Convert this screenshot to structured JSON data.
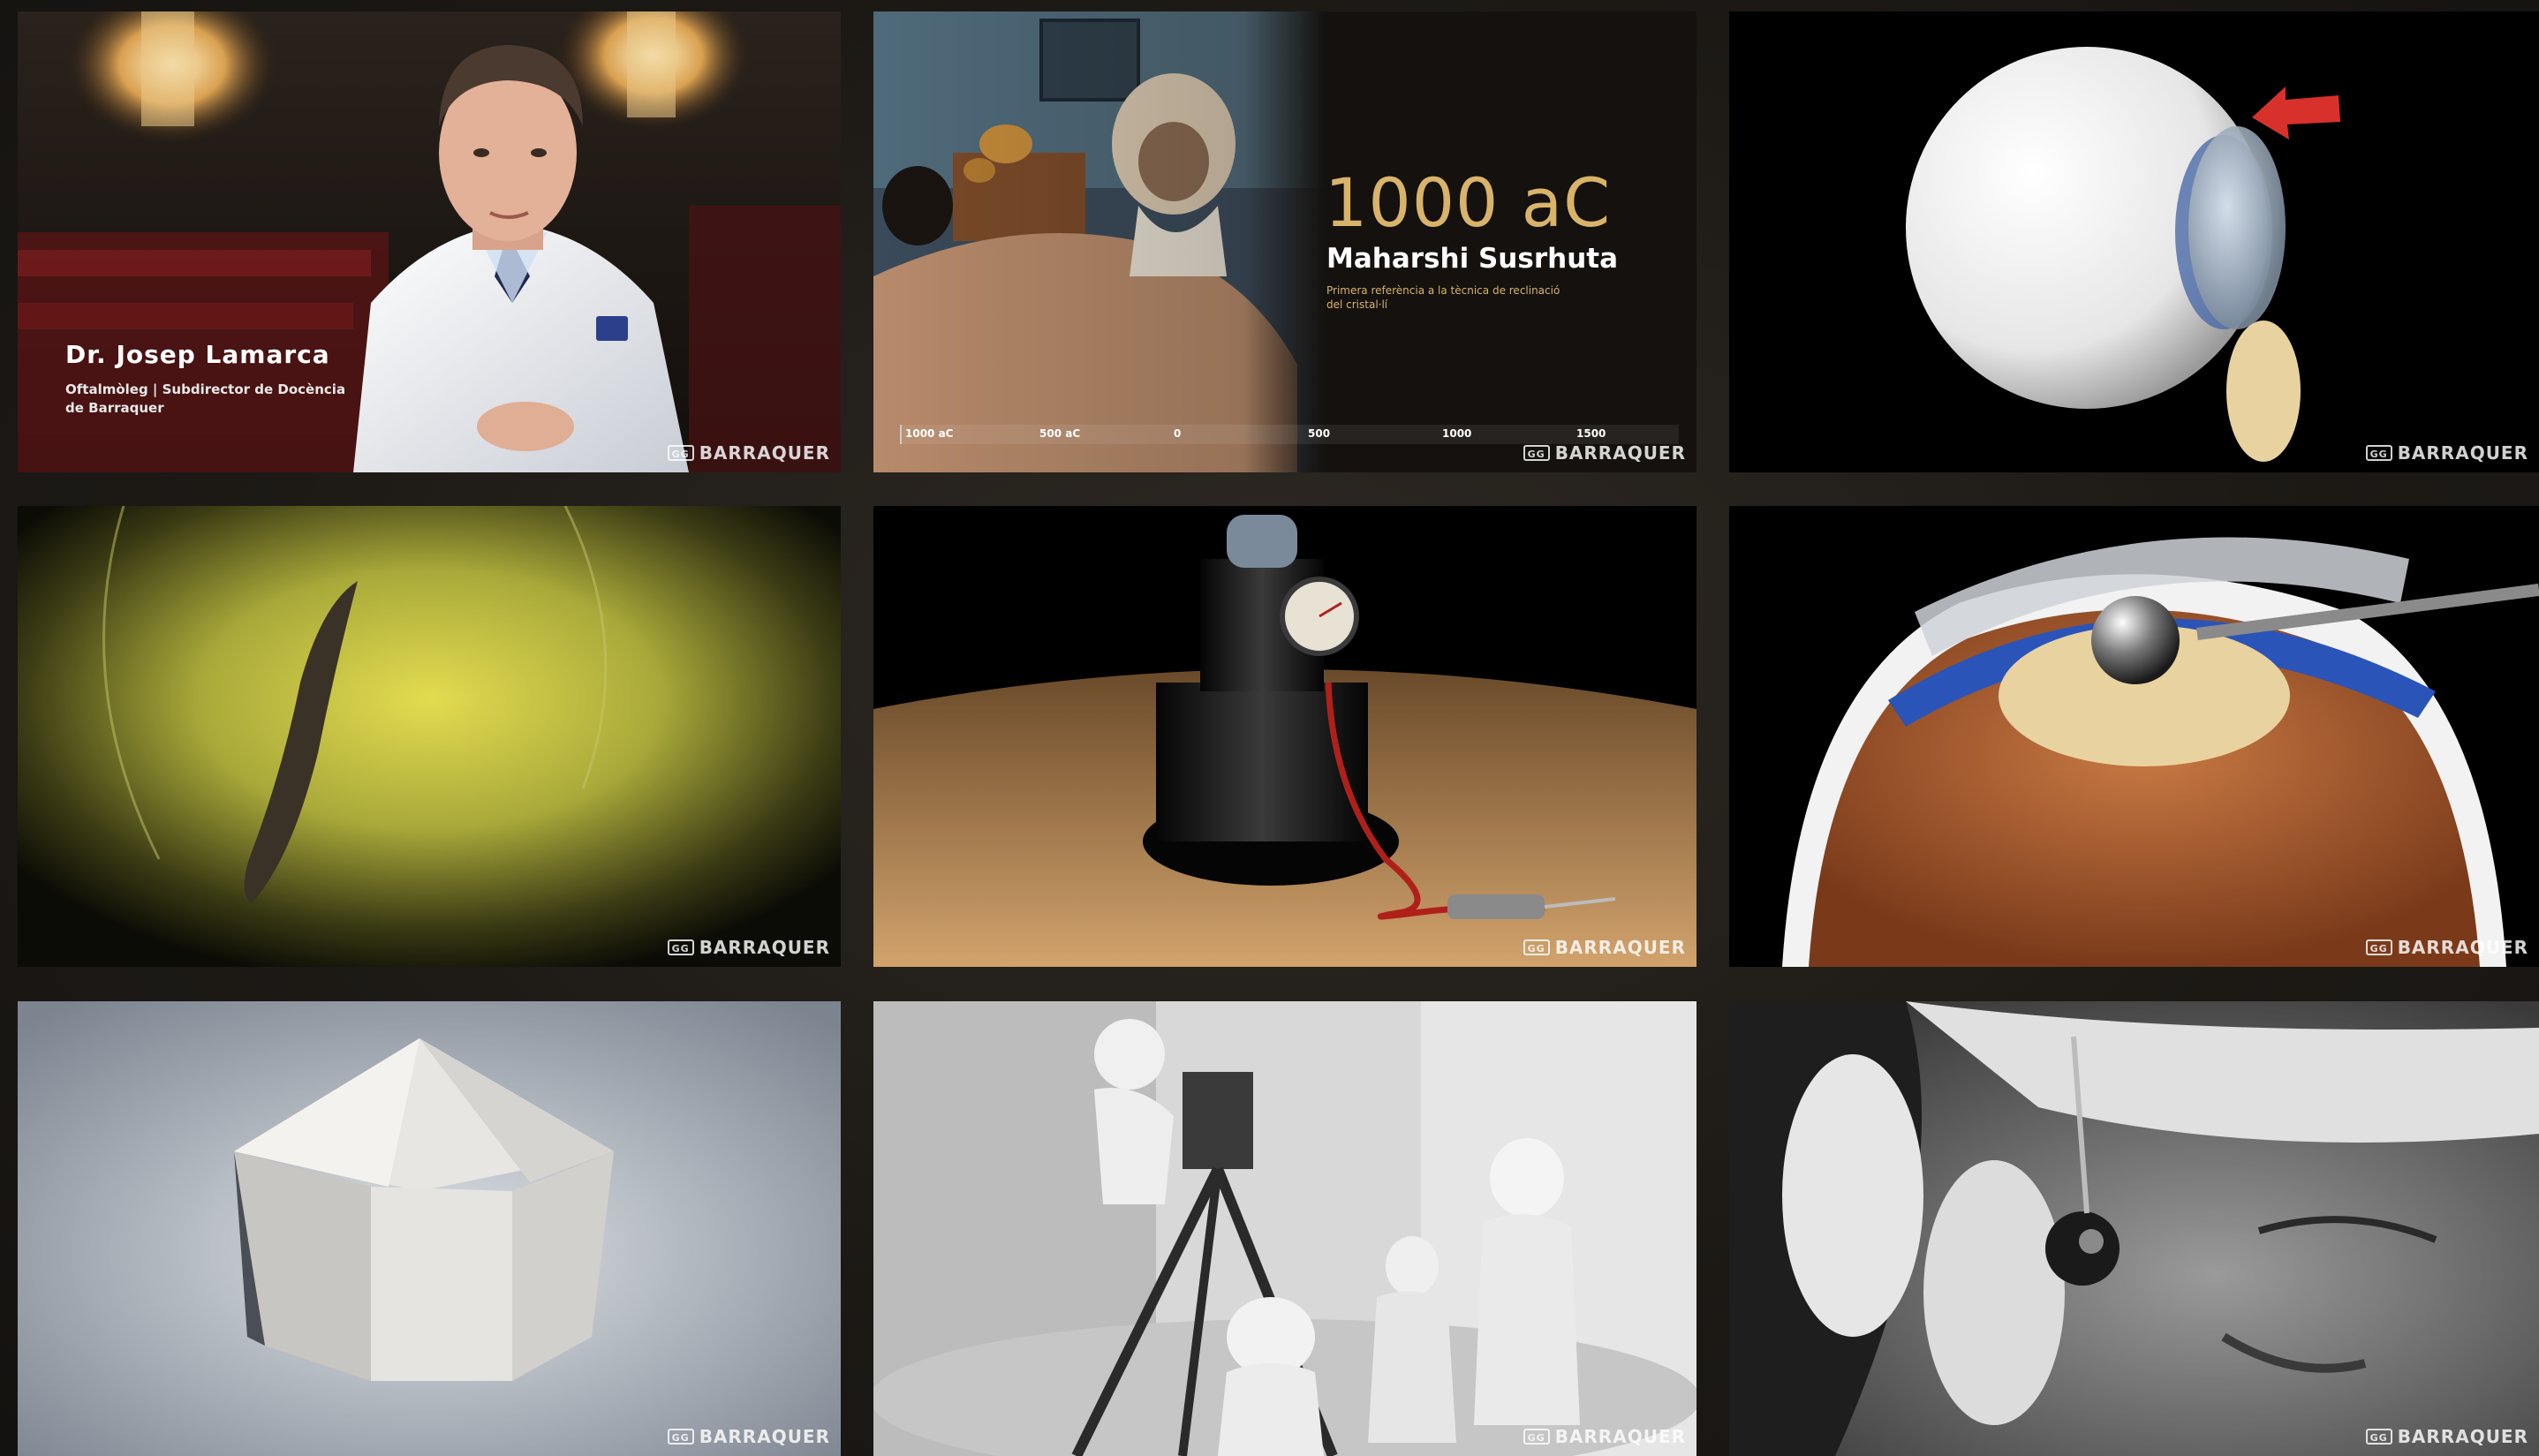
{
  "brand": {
    "watermark": "BARRAQUER",
    "logo_mark": "GG"
  },
  "tiles": {
    "interview": {
      "name": "Dr. Josep Lamarca",
      "role_line1": "Oftalmòleg | Subdirector de Docència",
      "role_line2": "de Barraquer"
    },
    "history": {
      "year": "1000 aC",
      "person": "Maharshi Susrhuta",
      "note_line1": "Primera referència a la tècnica de reclinació",
      "note_line2": "del cristal·lí",
      "timeline": [
        "1000 aC",
        "500 aC",
        "0",
        "500",
        "1000",
        "1500"
      ]
    }
  },
  "colors": {
    "accent_gold": "#d9b36a",
    "background": "#1c1915",
    "arrow_red": "#d8302a"
  }
}
